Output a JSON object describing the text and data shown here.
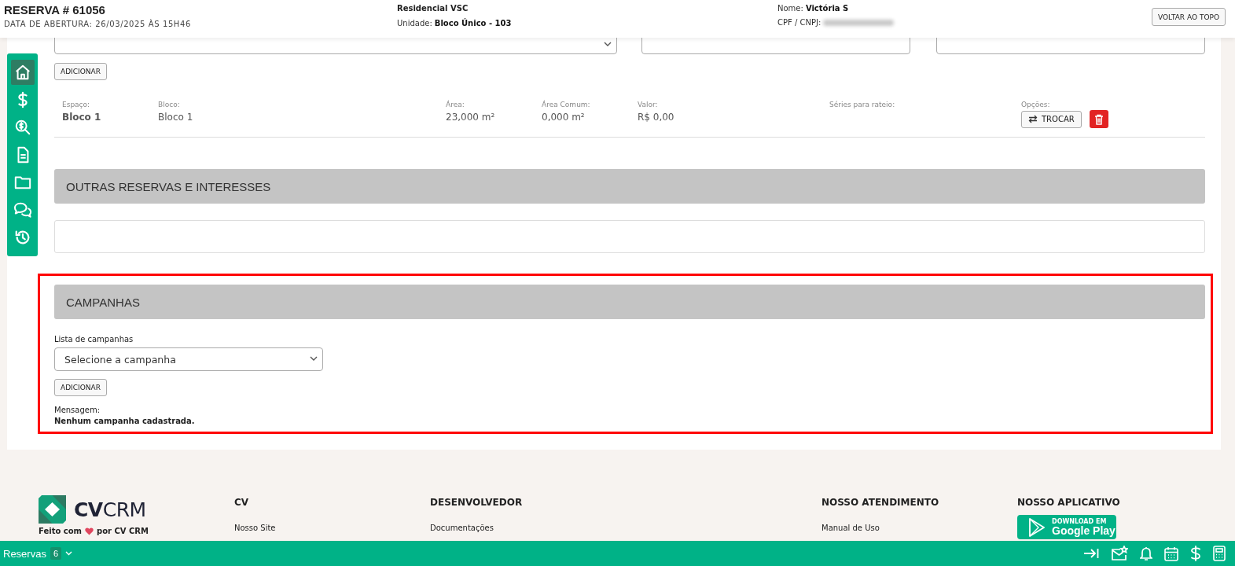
{
  "header": {
    "title": "RESERVA # 61056",
    "opened": "DATA DE ABERTURA: 26/03/2025 ÀS 15H46",
    "project": "Residencial VSC",
    "unit_label": "Unidade:",
    "unit": "Bloco Único - 103",
    "name_label": "Nome:",
    "name": "Victória S",
    "cpf_label": "CPF / CNPJ:",
    "back_button": "VOLTAR AO TOPO"
  },
  "sidebar": {
    "items": [
      {
        "kind": "home",
        "selected": true
      },
      {
        "kind": "dollar",
        "selected": false
      },
      {
        "kind": "search-dollar",
        "selected": false
      },
      {
        "kind": "document",
        "selected": false
      },
      {
        "kind": "folder",
        "selected": false
      },
      {
        "kind": "chat",
        "selected": false
      },
      {
        "kind": "history",
        "selected": false
      }
    ]
  },
  "units": {
    "add_button": "ADICIONAR",
    "fields": [
      {
        "label": "Espaço:",
        "value": "Bloco 1"
      },
      {
        "label": "Bloco:",
        "value": "Bloco 1"
      },
      {
        "label": "Área:",
        "value": "23,000 m²"
      },
      {
        "label": "Área Comum:",
        "value": "0,000 m²"
      },
      {
        "label": "Valor:",
        "value": "R$ 0,00"
      },
      {
        "label": "Séries para rateio:"
      }
    ],
    "options_label": "Opções:",
    "swap_button": "TROCAR"
  },
  "other_reservations": {
    "title": "OUTRAS RESERVAS E INTERESSES"
  },
  "campaigns": {
    "title": "CAMPANHAS",
    "list_label": "Lista de campanhas",
    "select_placeholder": "Selecione a campanha",
    "add_button": "ADICIONAR",
    "message_label": "Mensagem:",
    "message": "Nenhum campanha cadastrada."
  },
  "footer": {
    "logo": {
      "bold": "CV",
      "light": "CRM"
    },
    "tagline_before": "Feito com",
    "tagline_after": "por CV CRM",
    "columns": [
      {
        "title": "CV",
        "links": [
          "Nosso Site"
        ]
      },
      {
        "title": "DESENVOLVEDOR",
        "links": [
          "Documentações"
        ]
      },
      {
        "title": "NOSSO ATENDIMENTO",
        "links": [
          "Manual de Uso"
        ]
      },
      {
        "title": "NOSSO APLICATIVO",
        "app_badge": {
          "small": "DOWNLOAD EM",
          "big": "Google Play"
        }
      }
    ]
  },
  "bottom_bar": {
    "label": "Reservas",
    "count": "6"
  }
}
